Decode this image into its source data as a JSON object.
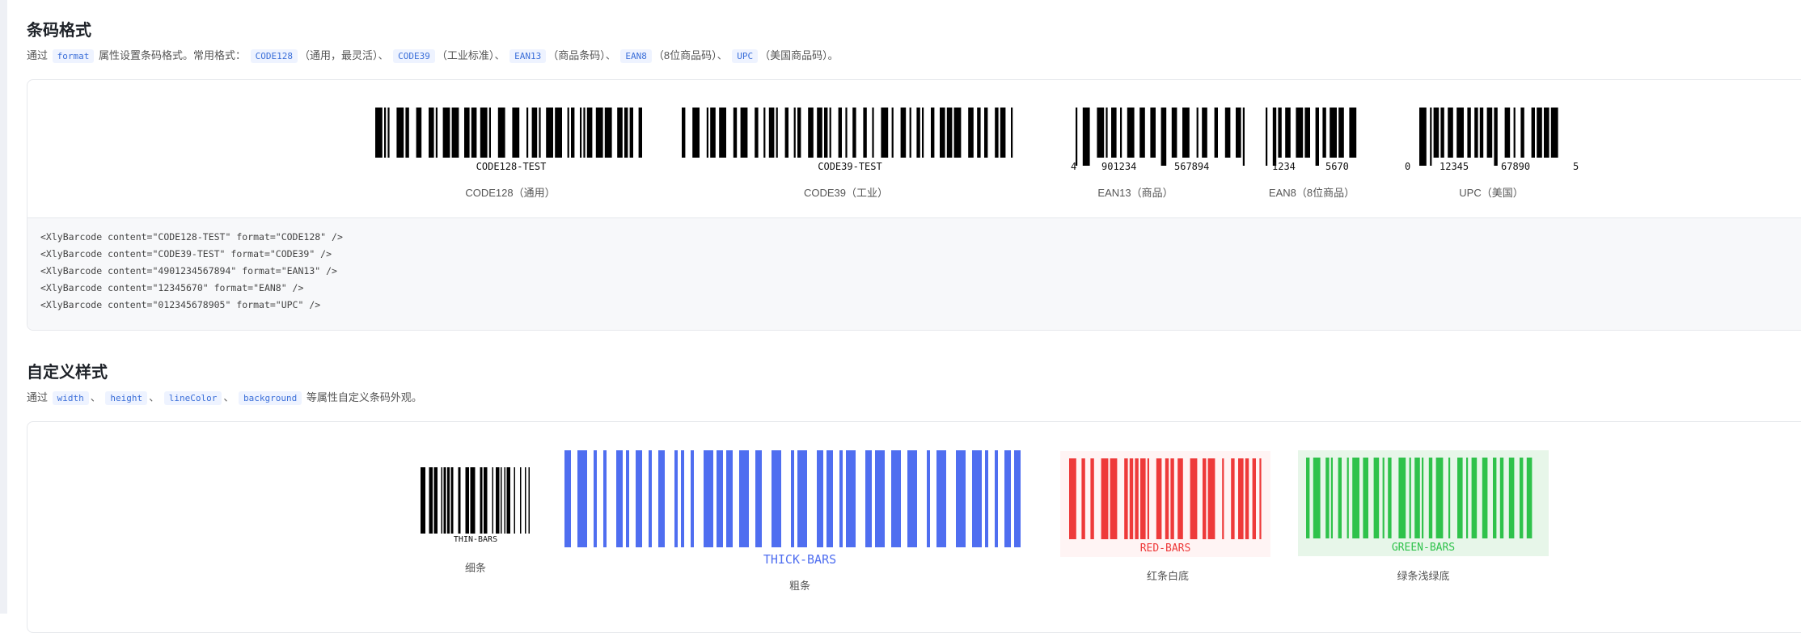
{
  "format_section": {
    "title": "条码格式",
    "desc_prefix": "通过",
    "desc_attr": "format",
    "desc_mid": "属性设置条码格式。常用格式：",
    "formats": [
      {
        "code": "CODE128",
        "note": "（通用，最灵活）"
      },
      {
        "code": "CODE39",
        "note": "（工业标准）"
      },
      {
        "code": "EAN13",
        "note": "（商品条码）"
      },
      {
        "code": "EAN8",
        "note": "（8位商品码）"
      },
      {
        "code": "UPC",
        "note": "（美国商品码）。"
      }
    ],
    "separator": "、",
    "barcodes": {
      "code128": {
        "text": "CODE128-TEST",
        "caption": "CODE128（通用）"
      },
      "code39": {
        "text": "CODE39-TEST",
        "caption": "CODE39（工业）"
      },
      "ean13": {
        "lead": "4",
        "left": "901234",
        "right": "567894",
        "caption": "EAN13（商品）"
      },
      "ean8": {
        "left": "1234",
        "right": "5670",
        "caption": "EAN8（8位商品）"
      },
      "upc": {
        "lead": "0",
        "left": "12345",
        "right": "67890",
        "trail": "5",
        "caption": "UPC（美国）"
      }
    },
    "code_lines": [
      "<XlyBarcode content=\"CODE128-TEST\" format=\"CODE128\" />",
      "<XlyBarcode content=\"CODE39-TEST\" format=\"CODE39\" />",
      "<XlyBarcode content=\"4901234567894\" format=\"EAN13\" />",
      "<XlyBarcode content=\"12345670\" format=\"EAN8\" />",
      "<XlyBarcode content=\"012345678905\" format=\"UPC\" />"
    ]
  },
  "style_section": {
    "title": "自定义样式",
    "desc_prefix": "通过",
    "attrs": [
      "width",
      "height",
      "lineColor",
      "background"
    ],
    "separator": "、",
    "desc_suffix": "等属性自定义条码外观。",
    "barcodes": {
      "thin": {
        "text": "THIN-BARS",
        "caption": "细条"
      },
      "thick": {
        "text": "THICK-BARS",
        "caption": "粗条"
      },
      "red": {
        "text": "RED-BARS",
        "caption": "红条白底"
      },
      "green": {
        "text": "GREEN-BARS",
        "caption": "绿条浅绿底"
      }
    }
  },
  "colors": {
    "black": "#000000",
    "blue": "#4f6ef0",
    "red": "#ee3a3a",
    "red_bg": "#fff4f4",
    "green": "#2fc24b",
    "green_bg": "#e7f6e9"
  }
}
